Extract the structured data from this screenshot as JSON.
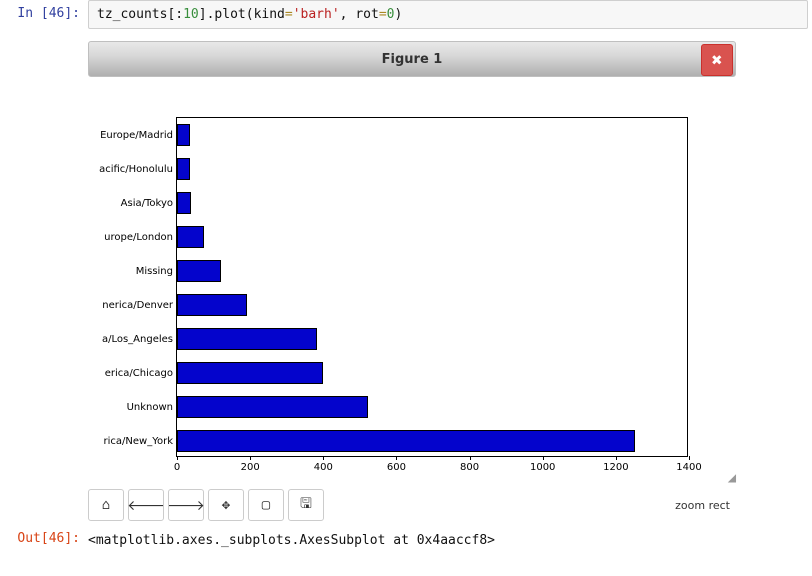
{
  "input": {
    "prompt_prefix": "In [",
    "prompt_num": "46",
    "prompt_suffix": "]:",
    "code_parts": {
      "v1": "tz_counts",
      "b1": "[:",
      "n1": "10",
      "b2": "].",
      "v2": "plot",
      "p1": "(",
      "v3": "kind",
      "eq": "=",
      "s1": "'barh'",
      "c1": ", ",
      "v4": "rot",
      "eq2": "=",
      "n2": "0",
      "p2": ")"
    }
  },
  "figure": {
    "title": "Figure 1",
    "close": "✖",
    "resize_glyph": "◢",
    "toolbar_msg": "zoom rect",
    "toolbar": {
      "home": "⌂",
      "back": "🡐",
      "forward": "🡒",
      "pan": "✥",
      "zoom": "▢",
      "save": "🖫"
    }
  },
  "chart_data": {
    "type": "bar",
    "orientation": "horizontal",
    "categories": [
      "Europe/Madrid",
      "acific/Honolulu",
      "Asia/Tokyo",
      "urope/London",
      "Missing",
      "nerica/Denver",
      "a/Los_Angeles",
      "erica/Chicago",
      "Unknown",
      "rica/New_York"
    ],
    "values": [
      35,
      36,
      37,
      74,
      120,
      191,
      382,
      400,
      521,
      1251
    ],
    "xlim": [
      0,
      1400
    ],
    "xticks": [
      0,
      200,
      400,
      600,
      800,
      1000,
      1200,
      1400
    ],
    "title": "",
    "xlabel": "",
    "ylabel": ""
  },
  "output": {
    "prompt_prefix": "Out[",
    "prompt_num": "46",
    "prompt_suffix": "]:",
    "text": "<matplotlib.axes._subplots.AxesSubplot at 0x4aaccf8>"
  }
}
